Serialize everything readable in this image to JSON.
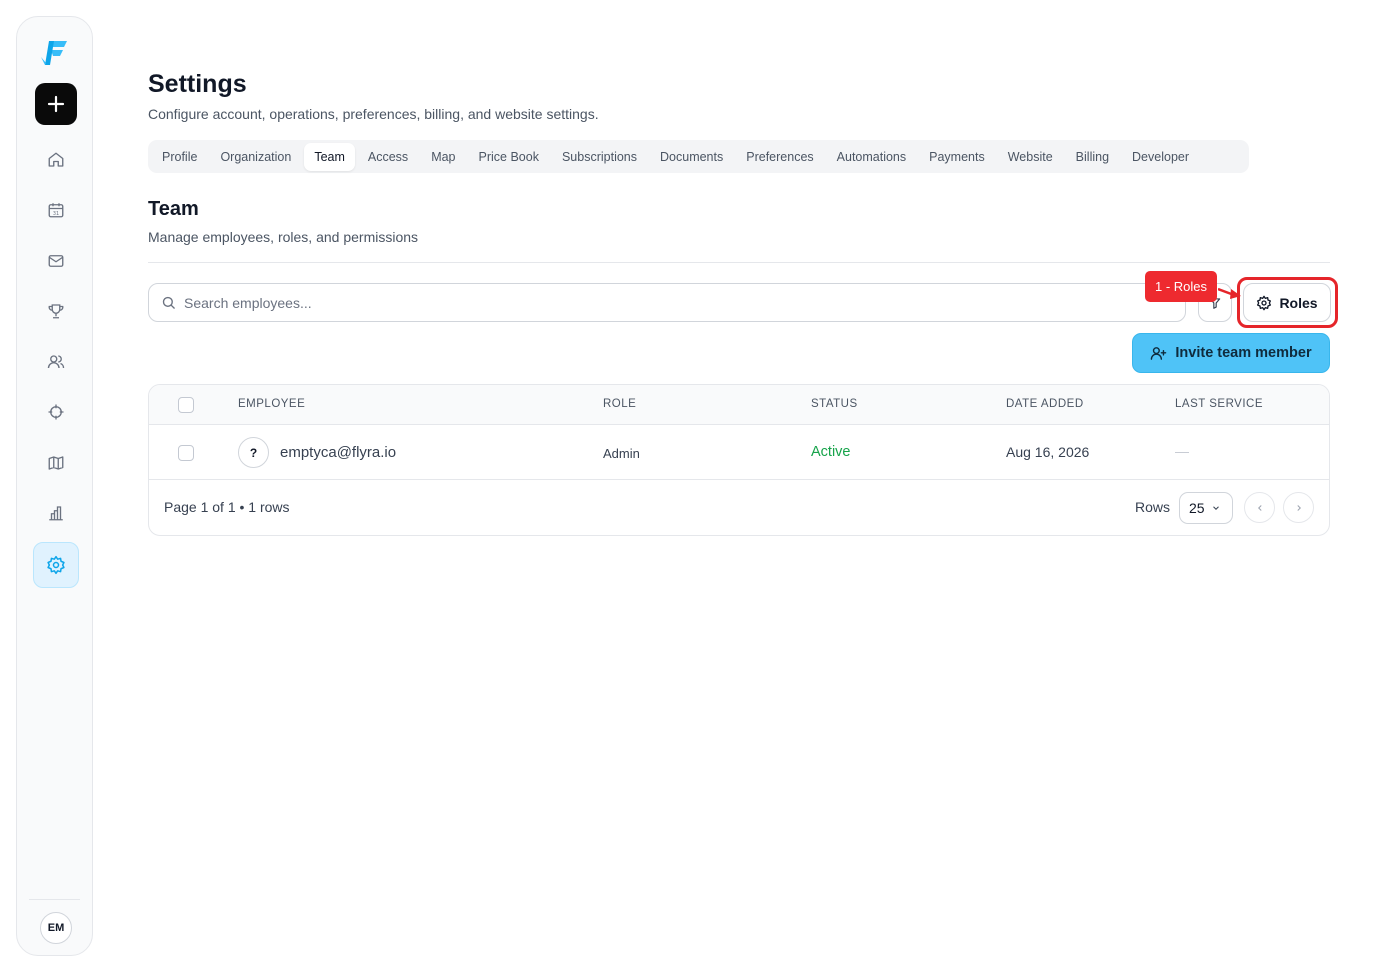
{
  "sidebar": {
    "avatar_initials": "EM",
    "items": [
      {
        "name": "home-icon"
      },
      {
        "name": "calendar-icon",
        "day": "31"
      },
      {
        "name": "mail-icon"
      },
      {
        "name": "trophy-icon"
      },
      {
        "name": "users-icon"
      },
      {
        "name": "crosshair-icon"
      },
      {
        "name": "map-icon"
      },
      {
        "name": "bar-chart-icon"
      },
      {
        "name": "gear-icon",
        "active": true
      }
    ],
    "accent_color": "#0ea5e9"
  },
  "header": {
    "title": "Settings",
    "subtitle": "Configure account, operations, preferences, billing, and website settings."
  },
  "tabs": [
    {
      "label": "Profile"
    },
    {
      "label": "Organization"
    },
    {
      "label": "Team",
      "active": true
    },
    {
      "label": "Access"
    },
    {
      "label": "Map"
    },
    {
      "label": "Price Book"
    },
    {
      "label": "Subscriptions"
    },
    {
      "label": "Documents"
    },
    {
      "label": "Preferences"
    },
    {
      "label": "Automations"
    },
    {
      "label": "Payments"
    },
    {
      "label": "Website"
    },
    {
      "label": "Billing"
    },
    {
      "label": "Developer"
    }
  ],
  "team": {
    "title": "Team",
    "subtitle": "Manage employees, roles, and permissions",
    "search_placeholder": "Search employees...",
    "roles_label": "Roles",
    "invite_label": "Invite team member",
    "annotation": "1 - Roles"
  },
  "table": {
    "headers": [
      "EMPLOYEE",
      "ROLE",
      "STATUS",
      "DATE ADDED",
      "LAST SERVICE"
    ],
    "rows": [
      {
        "avatar": "?",
        "employee": "emptyca@flyra.io",
        "role": "Admin",
        "status": "Active",
        "date_added": "Aug 16, 2026",
        "last_service": "—"
      }
    ],
    "footer": {
      "page_info": "Page 1 of 1 • 1 rows",
      "rows_label": "Rows",
      "rows_value": "25"
    }
  },
  "colors": {
    "status_active": "#16a34a",
    "invite_bg": "#4fc3f7",
    "annotation": "#ee2a2f"
  }
}
